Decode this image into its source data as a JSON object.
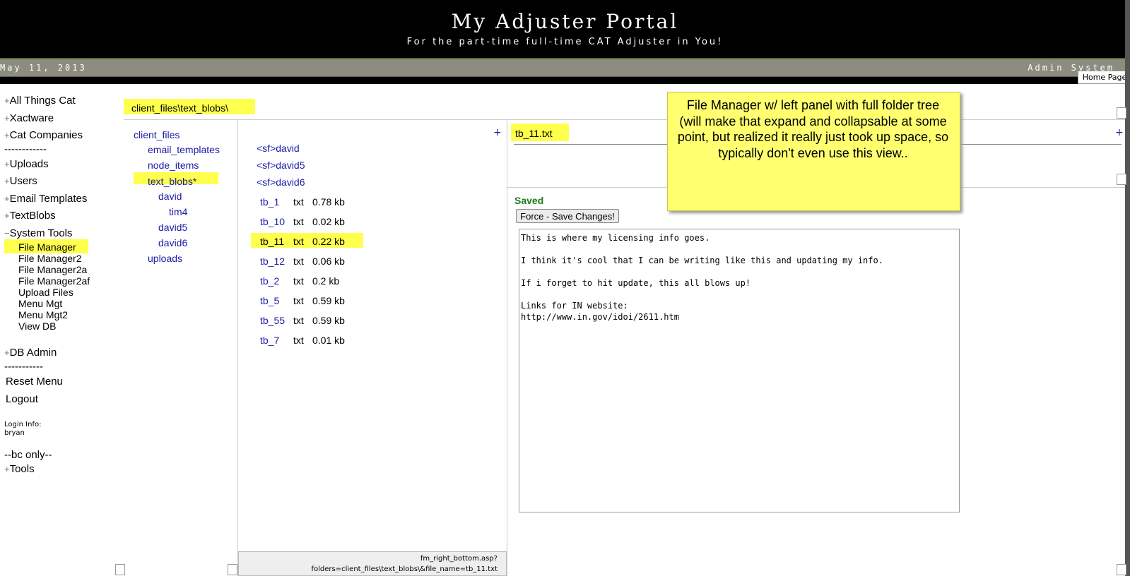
{
  "header": {
    "title": "My Adjuster Portal",
    "subtitle": "For the part-time full-time CAT Adjuster in You!",
    "date": "May 11, 2013",
    "system": "Admin System",
    "home_link": "Home Page"
  },
  "menu": {
    "all_things_cat": "All Things Cat",
    "xactware": "Xactware",
    "cat_companies": "Cat Companies",
    "sep1": "------------",
    "uploads": "Uploads",
    "users": "Users",
    "email_templates": "Email Templates",
    "textblobs": "TextBlobs",
    "system_tools": "System Tools",
    "system_tools_items": [
      "File Manager",
      "File Manager2",
      "File Manager2a",
      "File Manager2af",
      "Upload Files",
      "Menu Mgt",
      "Menu Mgt2",
      "View DB"
    ],
    "db_admin": "DB Admin",
    "sep2": "-----------",
    "reset_menu": "Reset Menu",
    "logout": "Logout",
    "login_info_label": "Login Info:",
    "login_user": "bryan",
    "bc_only": "--bc only--",
    "tools": "Tools",
    "plus": "+",
    "minus": "−"
  },
  "path": "client_files\\text_blobs\\",
  "folder_tree": [
    "client_files",
    "email_templates",
    "node_items",
    "text_blobs",
    "david",
    "tim4",
    "david5",
    "david6",
    "uploads"
  ],
  "folder_selected_marker": "*",
  "file_list": {
    "plus": "+",
    "subfolders": [
      "<sf>david",
      "<sf>david5",
      "<sf>david6"
    ],
    "files": [
      {
        "name": "tb_1",
        "ext": "txt",
        "size": "0.78 kb"
      },
      {
        "name": "tb_10",
        "ext": "txt",
        "size": "0.02 kb"
      },
      {
        "name": "tb_11",
        "ext": "txt",
        "size": "0.22 kb"
      },
      {
        "name": "tb_12",
        "ext": "txt",
        "size": "0.06 kb"
      },
      {
        "name": "tb_2",
        "ext": "txt",
        "size": "0.2 kb"
      },
      {
        "name": "tb_5",
        "ext": "txt",
        "size": "0.59 kb"
      },
      {
        "name": "tb_55",
        "ext": "txt",
        "size": "0.59 kb"
      },
      {
        "name": "tb_7",
        "ext": "txt",
        "size": "0.01 kb"
      }
    ],
    "status_url_line1": "fm_right_bottom.asp?",
    "status_url_line2": "folders=client_files\\text_blobs\\&file_name=tb_11.txt"
  },
  "editor": {
    "filename": "tb_11.txt",
    "plus": "+",
    "saved": "Saved",
    "force_save": "Force - Save Changes!",
    "content": "This is where my licensing info goes.\n\nI think it's cool that I can be writing like this and updating my info.\n\nIf i forget to hit update, this all blows up!\n\nLinks for IN website:\nhttp://www.in.gov/idoi/2611.htm"
  },
  "callout": {
    "text": "File Manager w/ left panel with full folder tree (will make that expand and collapsable at some point, but realized it really just took up space, so typically don't even use this view.."
  },
  "colors": {
    "highlight": "#ffff4d",
    "link": "#1a1aa6",
    "saved": "#1e7b1e",
    "callout": "#ffff70"
  }
}
